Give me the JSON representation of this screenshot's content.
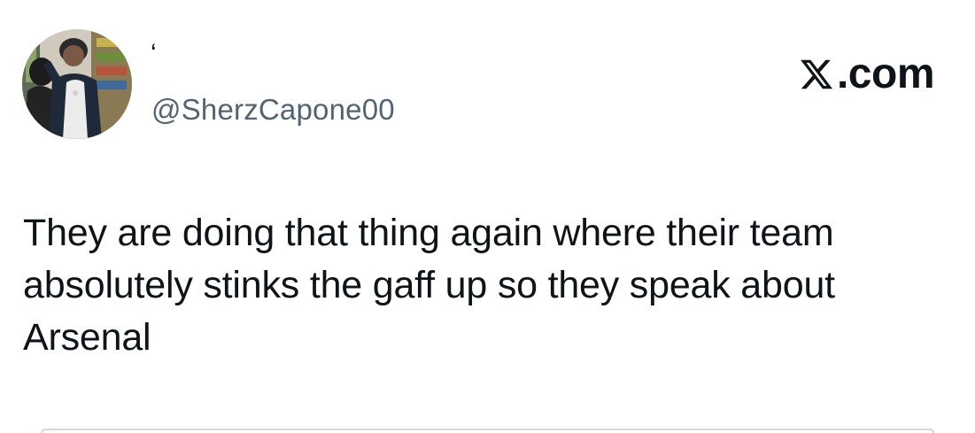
{
  "tweet": {
    "display_name": "‘",
    "handle": "@SherzCapone00",
    "brand_text": ".com",
    "brand_logo_icon": "x-logo-icon",
    "text": "They are doing that thing again where their team\nabsolutely stinks the gaff up so they speak about\nArsenal"
  },
  "colors": {
    "text_primary": "#0f1419",
    "text_secondary": "#536471",
    "divider": "#cfd9de",
    "background": "#ffffff"
  }
}
